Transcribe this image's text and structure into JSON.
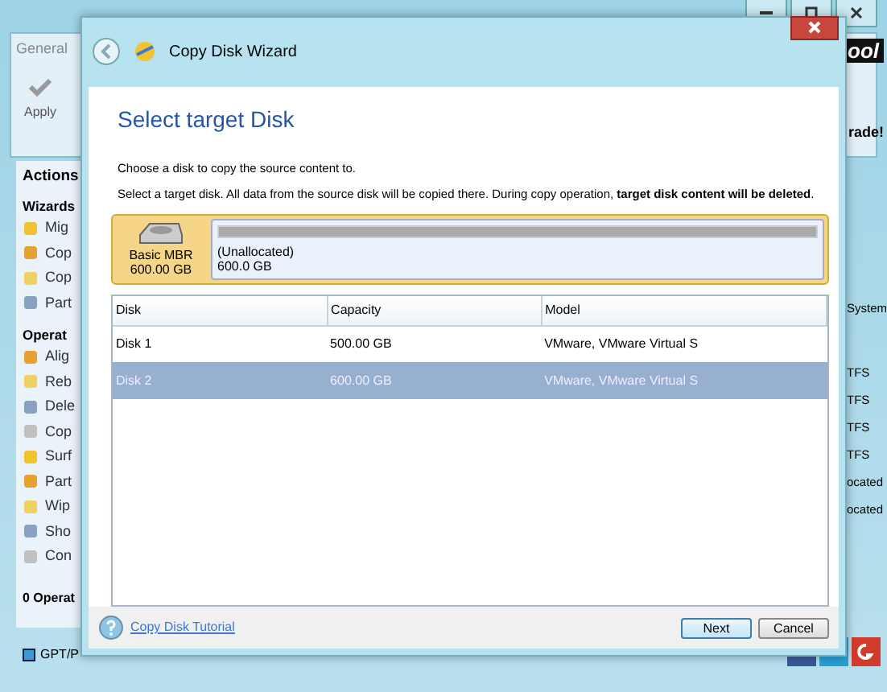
{
  "app": {
    "ribbon_tab": "General",
    "logo_text": "ool",
    "apply": "Apply",
    "upgrade": "rade!",
    "actions_title": "Actions",
    "sections": [
      {
        "title": "Wizards",
        "items": [
          "Mig",
          "Cop",
          "Cop",
          "Part"
        ]
      },
      {
        "title": "Operat",
        "items": [
          "Alig",
          "Reb",
          "Dele",
          "Cop",
          "Surf",
          "Part",
          "Wip",
          "Sho",
          "Con"
        ]
      }
    ],
    "pending": "0 Operat",
    "legend": "GPT/P",
    "right_cells": [
      "System",
      "TFS",
      "TFS",
      "TFS",
      "TFS",
      "ocated",
      "ocated"
    ]
  },
  "dialog": {
    "title": "Copy Disk Wizard",
    "heading": "Select target Disk",
    "instruction": "Choose a disk to copy the source content to.",
    "warning": "Select a target disk. All data from the source disk will be copied there. During copy operation, **target disk content will be deleted**.",
    "disk_map": {
      "type": "Basic MBR",
      "size": "600.00 GB",
      "partition": "(Unallocated)",
      "partition_size": "600.0 GB"
    },
    "table": {
      "columns": [
        "Disk",
        "Capacity",
        "Model"
      ],
      "rows": [
        {
          "cells": [
            "Disk 1",
            "500.00 GB",
            "VMware, VMware Virtual S"
          ],
          "selected": false
        },
        {
          "cells": [
            "Disk 2",
            "600.00 GB",
            "VMware, VMware Virtual S"
          ],
          "selected": true
        }
      ]
    },
    "tutorial_link": "Copy Disk Tutorial",
    "buttons": [
      "Next",
      "Cancel"
    ]
  }
}
